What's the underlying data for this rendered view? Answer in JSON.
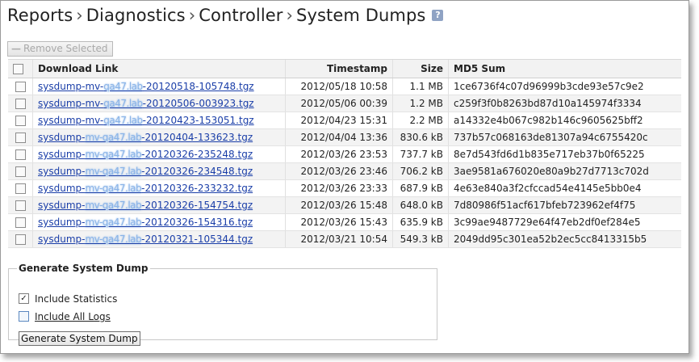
{
  "breadcrumb": [
    "Reports",
    "Diagnostics",
    "Controller",
    "System Dumps"
  ],
  "breadcrumb_separator": "›",
  "help_label": "?",
  "toolbar": {
    "remove_label": "Remove Selected",
    "remove_icon": "minus-icon"
  },
  "table": {
    "headers": {
      "link": "Download Link",
      "timestamp": "Timestamp",
      "size": "Size",
      "md5": "MD5 Sum"
    },
    "rows": [
      {
        "pre": "sysdump-mv-",
        "obscured": "qa47.lab",
        "post": "-20120518-105748.tgz",
        "timestamp": "2012/05/18 10:58",
        "size": "1.1 MB",
        "md5": "1ce6736f4c07d96999b3cde93e57c9e2"
      },
      {
        "pre": "sysdump-mv-",
        "obscured": "qa47.lab",
        "post": "-20120506-003923.tgz",
        "timestamp": "2012/05/06 00:39",
        "size": "1.2 MB",
        "md5": "c259f3f0b8263bd87d10a145974f3334"
      },
      {
        "pre": "sysdump-mv-",
        "obscured": "qa47.lab",
        "post": "-20120423-153051.tgz",
        "timestamp": "2012/04/23 15:31",
        "size": "2.2 MB",
        "md5": "a14332e4b067c982b146c9605625bff2"
      },
      {
        "pre": "sysdump-",
        "obscured": "mv-qa47.lab",
        "post": "-20120404-133623.tgz",
        "timestamp": "2012/04/04 13:36",
        "size": "830.6 kB",
        "md5": "737b57c068163de81307a94c6755420c"
      },
      {
        "pre": "sysdump-",
        "obscured": "mv-qa47.lab",
        "post": "-20120326-235248.tgz",
        "timestamp": "2012/03/26 23:53",
        "size": "737.7 kB",
        "md5": "8e7d543fd6d1b835e717eb37b0f65225"
      },
      {
        "pre": "sysdump-",
        "obscured": "mv-qa47.lab",
        "post": "-20120326-234548.tgz",
        "timestamp": "2012/03/26 23:46",
        "size": "706.2 kB",
        "md5": "3ae9581a676020e80a9b27d7713c702d"
      },
      {
        "pre": "sysdump-",
        "obscured": "mv-qa47.lab",
        "post": "-20120326-233232.tgz",
        "timestamp": "2012/03/26 23:33",
        "size": "687.9 kB",
        "md5": "4e63e840a3f2cfccad54e4145e5bb0e4"
      },
      {
        "pre": "sysdump-",
        "obscured": "mv-qa47.lab",
        "post": "-20120326-154754.tgz",
        "timestamp": "2012/03/26 15:48",
        "size": "648.0 kB",
        "md5": "7d80986f51acf617bfeb723962ef4f75"
      },
      {
        "pre": "sysdump-",
        "obscured": "mv-qa47.lab",
        "post": "-20120326-154316.tgz",
        "timestamp": "2012/03/26 15:43",
        "size": "635.9 kB",
        "md5": "3c99ae9487729e64f47eb2df0ef284e5"
      },
      {
        "pre": "sysdump-",
        "obscured": "mv-qa47.lab",
        "post": "-20120321-105344.tgz",
        "timestamp": "2012/03/21 10:54",
        "size": "549.3 kB",
        "md5": "2049dd95c301ea52b2ec5cc8413315b5"
      }
    ]
  },
  "generate": {
    "legend": "Generate System Dump",
    "include_statistics": {
      "label": "Include Statistics",
      "checked": true,
      "mark": "✓"
    },
    "include_all_logs": {
      "label": "Include All Logs",
      "checked": false
    },
    "button_label": "Generate System Dump"
  }
}
